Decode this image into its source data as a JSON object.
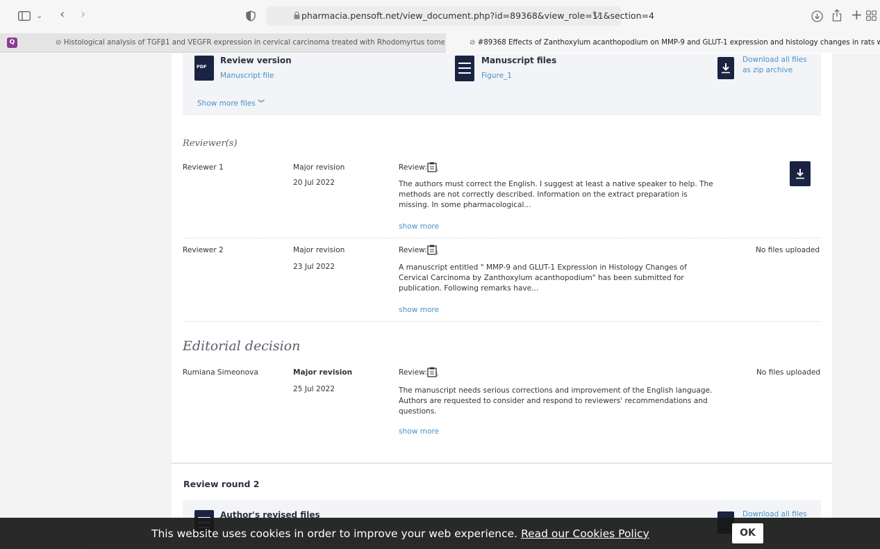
{
  "browser": {
    "url": "pharmacia.pensoft.net/view_document.php?id=89368&view_role=11&section=4",
    "tabs": [
      {
        "label": "Histological analysis of TGFβ1 and VEGFR expression in cervical carcinoma treated with Rhodomyrtus tomentosa",
        "active": false
      },
      {
        "label": "#89368 Effects of Zanthoxylum acanthopodium on MMP-9 and GLUT-1 expression and histology changes in rats with cer...",
        "active": true
      }
    ]
  },
  "files": {
    "review_version": {
      "title": "Review version",
      "link": "Manuscript file",
      "icon_label": "PDF"
    },
    "manuscript_files": {
      "title": "Manuscript files",
      "link": "Figure_1"
    },
    "download_all": {
      "line1": "Download all files",
      "line2": "as zip archive"
    },
    "show_more": "Show more files"
  },
  "reviewers": {
    "heading": "Reviewer(s)",
    "items": [
      {
        "name": "Reviewer 1",
        "decision": "Major revision",
        "date": "20 Jul 2022",
        "review_label": "Review:",
        "text": "The authors must correct the English. I suggest at least a native speaker to help. The methods are not correctly described. Information on the extract preparation is missing. In some pharmacological...",
        "show_more": "show more",
        "files": ""
      },
      {
        "name": "Reviewer 2",
        "decision": "Major revision",
        "date": "23 Jul 2022",
        "review_label": "Review:",
        "text": "A manuscript entitled \" MMP-9 and GLUT-1 Expression in Histology Changes of Cervical Carcinoma by Zanthoxylum acanthopodium\" has been submitted for publication. Following remarks have...",
        "show_more": "show more",
        "files": "No files uploaded"
      }
    ]
  },
  "editorial": {
    "heading": "Editorial decision",
    "name": "Rumiana Simeonova",
    "decision": "Major revision",
    "date": "25 Jul 2022",
    "review_label": "Review:",
    "text": "The manuscript needs serious corrections and improvement of the English language. Authors are requested to consider and respond to reviewers' recommendations and questions.",
    "show_more": "show more",
    "files": "No files uploaded"
  },
  "round2": {
    "title": "Review round 2",
    "files_title": "Author's revised files",
    "download_label": "Download all files"
  },
  "cookie": {
    "text": "This website uses cookies in order to improve your web experience.",
    "link": "Read our Cookies Policy",
    "ok": "OK"
  }
}
